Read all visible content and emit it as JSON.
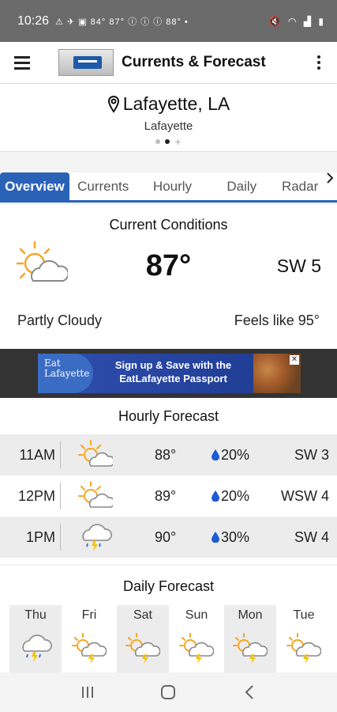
{
  "status_bar": {
    "time": "10:26",
    "left_icons": "⚠ ✈ ▣ 84° 87° ⓘ ⓘ ⓘ 88° •",
    "right_icons": "🔇 ◠ ▟ ▮"
  },
  "app_bar": {
    "title": "Currents & Forecast"
  },
  "location": {
    "name": "Lafayette, LA",
    "sub": "Lafayette"
  },
  "tabs": [
    {
      "label": "Overview"
    },
    {
      "label": "Currents"
    },
    {
      "label": "Hourly"
    },
    {
      "label": "Daily"
    },
    {
      "label": "Radar"
    }
  ],
  "current": {
    "title": "Current Conditions",
    "temp": "87°",
    "wind": "SW  5",
    "condition": "Partly Cloudy",
    "feels_like": "Feels like 95°",
    "icon": "partly-cloudy-icon"
  },
  "ad": {
    "logo_text": "Eat Lafayette",
    "headline": "Sign up & Save with the EatLafayette Passport"
  },
  "hourly": {
    "title": "Hourly Forecast",
    "rows": [
      {
        "time": "11AM",
        "temp": "88°",
        "precip": "20%",
        "wind": "SW  3",
        "icon": "partly-sunny-icon"
      },
      {
        "time": "12PM",
        "temp": "89°",
        "precip": "20%",
        "wind": "WSW  4",
        "icon": "partly-sunny-icon"
      },
      {
        "time": "1PM",
        "temp": "90°",
        "precip": "30%",
        "wind": "SW  4",
        "icon": "thunderstorm-icon"
      }
    ]
  },
  "daily": {
    "title": "Daily Forecast",
    "days": [
      {
        "day": "Thu",
        "icon": "thunderstorm-icon"
      },
      {
        "day": "Fri",
        "icon": "sun-thunder-icon"
      },
      {
        "day": "Sat",
        "icon": "sun-thunder-icon"
      },
      {
        "day": "Sun",
        "icon": "sun-thunder-icon"
      },
      {
        "day": "Mon",
        "icon": "sun-thunder-icon"
      },
      {
        "day": "Tue",
        "icon": "sun-thunder-icon"
      }
    ]
  },
  "colors": {
    "accent": "#2a62b8",
    "sun": "#f5a623",
    "drop": "#1e5ad6",
    "bolt": "#f2c200"
  }
}
